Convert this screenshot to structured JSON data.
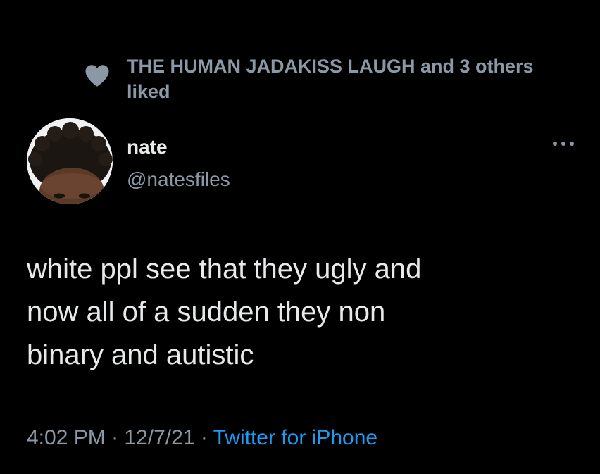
{
  "social_context": {
    "icon": "heart-icon",
    "text": "THE HUMAN JADAKISS LAUGH and 3 others liked"
  },
  "author": {
    "name": "nate",
    "handle": "@natesfiles",
    "avatar": "avatar"
  },
  "more_menu": {
    "icon": "more-dots-icon"
  },
  "tweet": {
    "text": "white ppl see that they ugly and\nnow all of a sudden they non\nbinary and autistic"
  },
  "meta": {
    "time": "4:02 PM",
    "separator": " · ",
    "date": "12/7/21",
    "source": "Twitter for iPhone"
  },
  "colors": {
    "background": "#000000",
    "primary_text": "#e7e9ea",
    "secondary_text": "#8b98a5",
    "link": "#1d9bf0"
  }
}
